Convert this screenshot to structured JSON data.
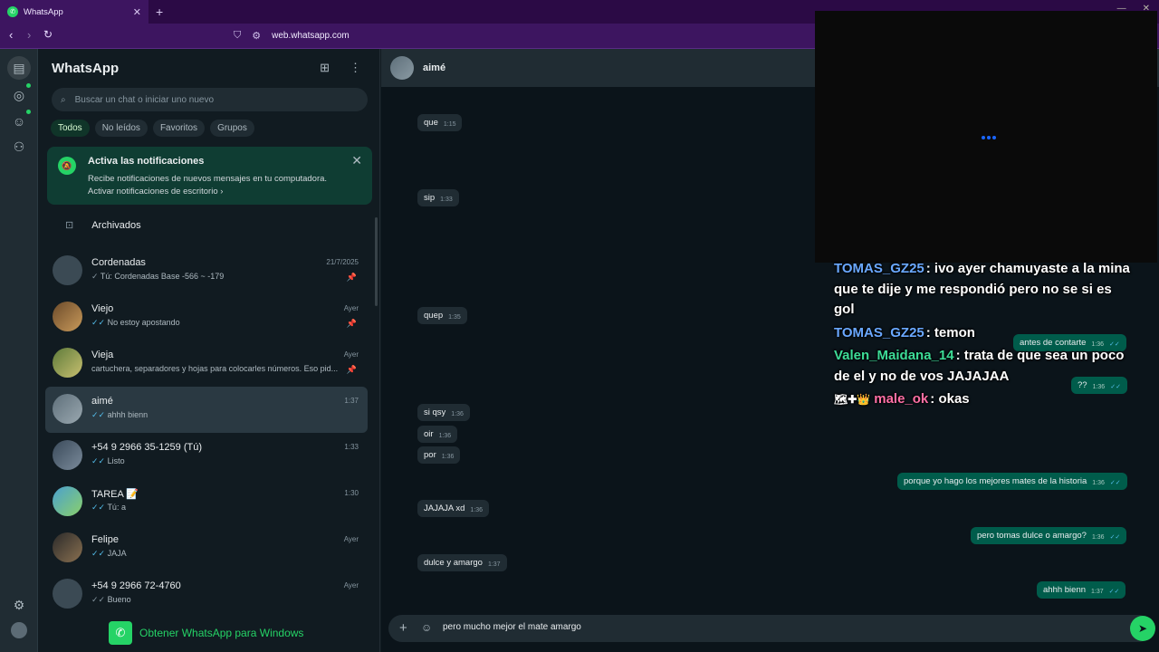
{
  "browser": {
    "tab_title": "WhatsApp",
    "url": "web.whatsapp.com"
  },
  "sidebar": {
    "title": "WhatsApp",
    "search_placeholder": "Buscar un chat o iniciar uno nuevo",
    "filters": [
      "Todos",
      "No leídos",
      "Favoritos",
      "Grupos"
    ],
    "notification": {
      "title": "Activa las notificaciones",
      "desc": "Recibe notificaciones de nuevos mensajes en tu computadora.",
      "link": "Activar notificaciones de escritorio"
    },
    "archived": "Archivados",
    "chats": [
      {
        "name": "Cordenadas",
        "time": "21/7/2025",
        "preview": "Tú: Cordenadas Base -566 ~ -179",
        "tick": "✓",
        "pinned": true
      },
      {
        "name": "Viejo",
        "time": "Ayer",
        "preview": "No estoy apostando",
        "tick": "✓✓",
        "pinned": true
      },
      {
        "name": "Vieja",
        "time": "Ayer",
        "preview": "cartuchera, separadores y hojas para colocarles números. Eso pid...",
        "tick": "",
        "pinned": true
      },
      {
        "name": "aimé",
        "time": "1:37",
        "preview": "ahhh bienn",
        "tick": "✓✓",
        "pinned": false
      },
      {
        "name": "+54 9 2966 35-1259 (Tú)",
        "time": "1:33",
        "preview": "Listo",
        "tick": "✓✓",
        "pinned": false
      },
      {
        "name": "TAREA",
        "time": "1:30",
        "preview": "Tú: a",
        "tick": "✓✓",
        "pinned": false
      },
      {
        "name": "Felipe",
        "time": "Ayer",
        "preview": "JAJA",
        "tick": "✓✓",
        "pinned": false
      },
      {
        "name": "+54 9 2966 72-4760",
        "time": "Ayer",
        "preview": "Bueno",
        "tick": "✓✓",
        "pinned": false
      }
    ],
    "get_app": "Obtener WhatsApp para Windows"
  },
  "chat": {
    "contact": "aimé",
    "incoming": [
      {
        "text": "que",
        "time": "1:15"
      },
      {
        "text": "sip",
        "time": "1:33"
      },
      {
        "text": "quep",
        "time": "1:35"
      },
      {
        "text": "si qsy",
        "time": "1:36"
      },
      {
        "text": "oir",
        "time": "1:36"
      },
      {
        "text": "por",
        "time": "1:36"
      },
      {
        "text": "JAJAJA xd",
        "time": "1:36"
      },
      {
        "text": "dulce y amargo",
        "time": "1:37"
      }
    ],
    "outgoing": [
      {
        "text": "antes de contarte",
        "time": "1:36"
      },
      {
        "text": "??",
        "time": "1:36"
      },
      {
        "text": "porque yo hago los mejores mates de la historia",
        "time": "1:36"
      },
      {
        "text": "pero tomas dulce o amargo?",
        "time": "1:36"
      },
      {
        "text": "ahhh bienn",
        "time": "1:37"
      }
    ],
    "composer_text": "pero mucho mejor el mate amargo"
  },
  "stream_chat": [
    {
      "user": "TOMAS_GZ25",
      "color": "#6aa8ff",
      "text": "ivo ayer chamuyaste a la mina que te dije y me respondió pero no se si es gol"
    },
    {
      "user": "TOMAS_GZ25",
      "color": "#6aa8ff",
      "text": "temon"
    },
    {
      "user": "Valen_Maidana_14",
      "color": "#3ddc97",
      "text": "trata de que sea un poco de el y no de vos JAJAJAA"
    },
    {
      "user": "male_ok",
      "color": "#ff6fa5",
      "text": "okas",
      "badges": "🗺✚👑"
    }
  ]
}
